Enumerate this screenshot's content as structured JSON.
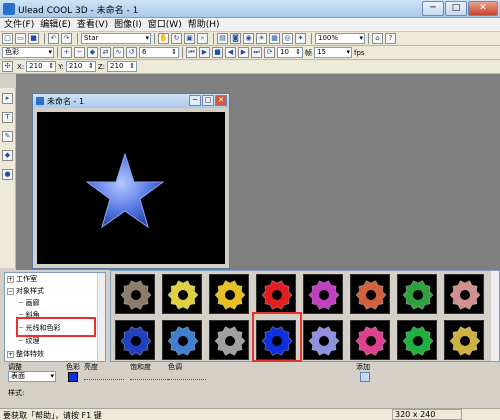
{
  "app": {
    "title": "Ulead COOL 3D - 未命名 - 1"
  },
  "window_buttons": {
    "minimize": "─",
    "maximize": "□",
    "close": "✕"
  },
  "menu": [
    "文件(F)",
    "编辑(E)",
    "查看(V)",
    "图像(I)",
    "窗口(W)",
    "帮助(H)"
  ],
  "toolbar1": {
    "object_combo": "Star",
    "zoom_combo": "100%"
  },
  "toolbar2": {
    "mode_combo": "色彩",
    "frame_value": "6",
    "total_frames": "10",
    "frames_label": "帧",
    "fps_value": "15",
    "fps_label": "fps"
  },
  "toolbar3": {
    "x_label": "X:",
    "x_value": "210",
    "y_label": "Y:",
    "y_value": "210",
    "z_label": "Z:",
    "z_value": "210"
  },
  "document": {
    "title": "未命名 - 1"
  },
  "tree": {
    "items": [
      {
        "label": "工作室",
        "expander": "+"
      },
      {
        "label": "对象样式",
        "expander": "−"
      },
      {
        "label": "画廊"
      },
      {
        "label": "斜角"
      },
      {
        "label": "光线和色彩"
      },
      {
        "label": "纹理"
      },
      {
        "label": "整体特效",
        "expander": "+"
      }
    ]
  },
  "gallery": {
    "thumbnails": [
      {
        "color": "#8a7d6a"
      },
      {
        "color": "#e0d040"
      },
      {
        "color": "#e6c020"
      },
      {
        "color": "#e02020"
      },
      {
        "color": "#c040c0"
      },
      {
        "color": "#d06040"
      },
      {
        "color": "#30a040"
      },
      {
        "color": "#d09090"
      },
      {
        "color": "#2040c0"
      },
      {
        "color": "#4080d0"
      },
      {
        "color": "#a0a0a0"
      },
      {
        "color": "#1030e0"
      },
      {
        "color": "#9090e0"
      },
      {
        "color": "#e04090"
      },
      {
        "color": "#20b040"
      },
      {
        "color": "#d0b040"
      }
    ],
    "highlight_color": "#e8322c"
  },
  "properties": {
    "adjust_label": "调整",
    "adjust_value": "表面",
    "color_label": "色彩",
    "brightness_label": "亮度",
    "saturation_label": "饱和度",
    "hue_label": "色调",
    "add_label": "添加",
    "style_label": "样式:"
  },
  "status": {
    "text": "要获取「帮助」，请按 F1 键",
    "resolution": "320 x 240"
  }
}
